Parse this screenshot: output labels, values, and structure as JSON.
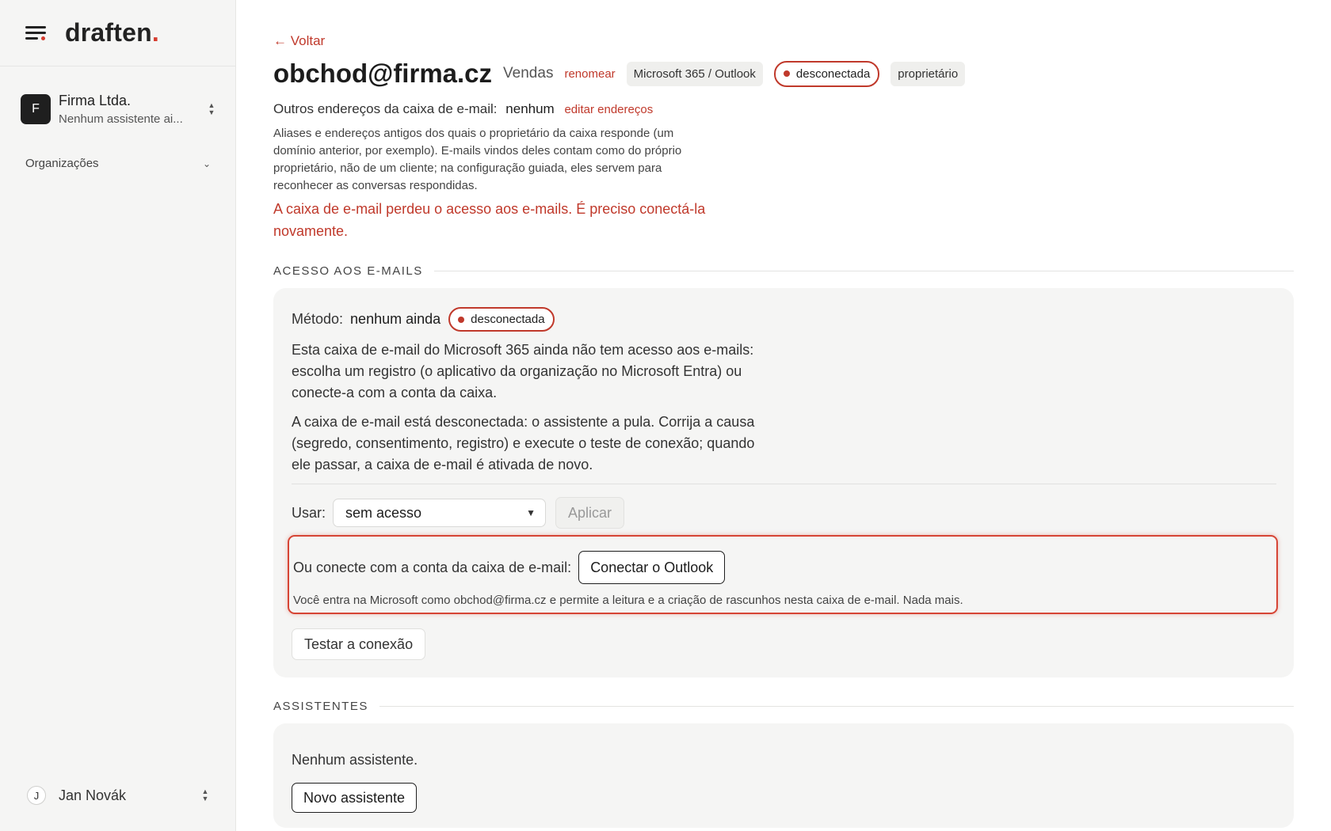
{
  "sidebar": {
    "logo_text": "draften",
    "logo_dot": ".",
    "org": {
      "initial": "F",
      "name": "Firma Ltda.",
      "subtitle": "Nenhum assistente ai..."
    },
    "organizations_label": "Organizações",
    "user": {
      "initial": "J",
      "name": "Jan Novák"
    }
  },
  "mailbox": {
    "back_label": "← Voltar",
    "address": "obchod@firma.cz",
    "label": "Vendas",
    "rename_label": "renomear",
    "provider_tag": "Microsoft 365 / Outlook",
    "status": "desconectada",
    "role_tag": "proprietário",
    "other_addresses_label": "Outros endereços da caixa de e-mail:",
    "other_addresses_value": "nenhum",
    "edit_addresses_label": "editar endereços",
    "aliases_help": "Aliases e endereços antigos dos quais o proprietário da caixa responde (um domínio anterior, por exemplo). E-mails vindos deles contam como do próprio proprietário, não de um cliente; na configuração guiada, eles servem para reconhecer as conversas respondidas.",
    "lost_access_warning": "A caixa de e-mail perdeu o acesso aos e-mails. É preciso conectá-la novamente."
  },
  "access": {
    "section_title": "ACESSO AOS E-MAILS",
    "method_label": "Método:",
    "method_value": "nenhum ainda",
    "status": "desconectada",
    "para1": "Esta caixa de e-mail do Microsoft 365 ainda não tem acesso aos e-mails: escolha um registro (o aplicativo da organização no Microsoft Entra) ou conecte-a com a conta da caixa.",
    "para2": "A caixa de e-mail está desconectada: o assistente a pula. Corrija a causa (segredo, consentimento, registro) e execute o teste de conexão; quando ele passar, a caixa de e-mail é ativada de novo.",
    "use_label": "Usar:",
    "use_selected": "sem acesso",
    "apply_label": "Aplicar",
    "oauth_label": "Ou conecte com a conta da caixa de e-mail:",
    "connect_label": "Conectar o Outlook",
    "oauth_note": "Você entra na Microsoft como obchod@firma.cz e permite a leitura e a criação de rascunhos nesta caixa de e-mail. Nada mais.",
    "test_label": "Testar a conexão"
  },
  "assistants": {
    "section_title": "ASSISTENTES",
    "empty_text": "Nenhum assistente.",
    "new_label": "Novo assistente"
  },
  "colors": {
    "accent": "#c0392b",
    "highlight_border": "#d64535"
  }
}
